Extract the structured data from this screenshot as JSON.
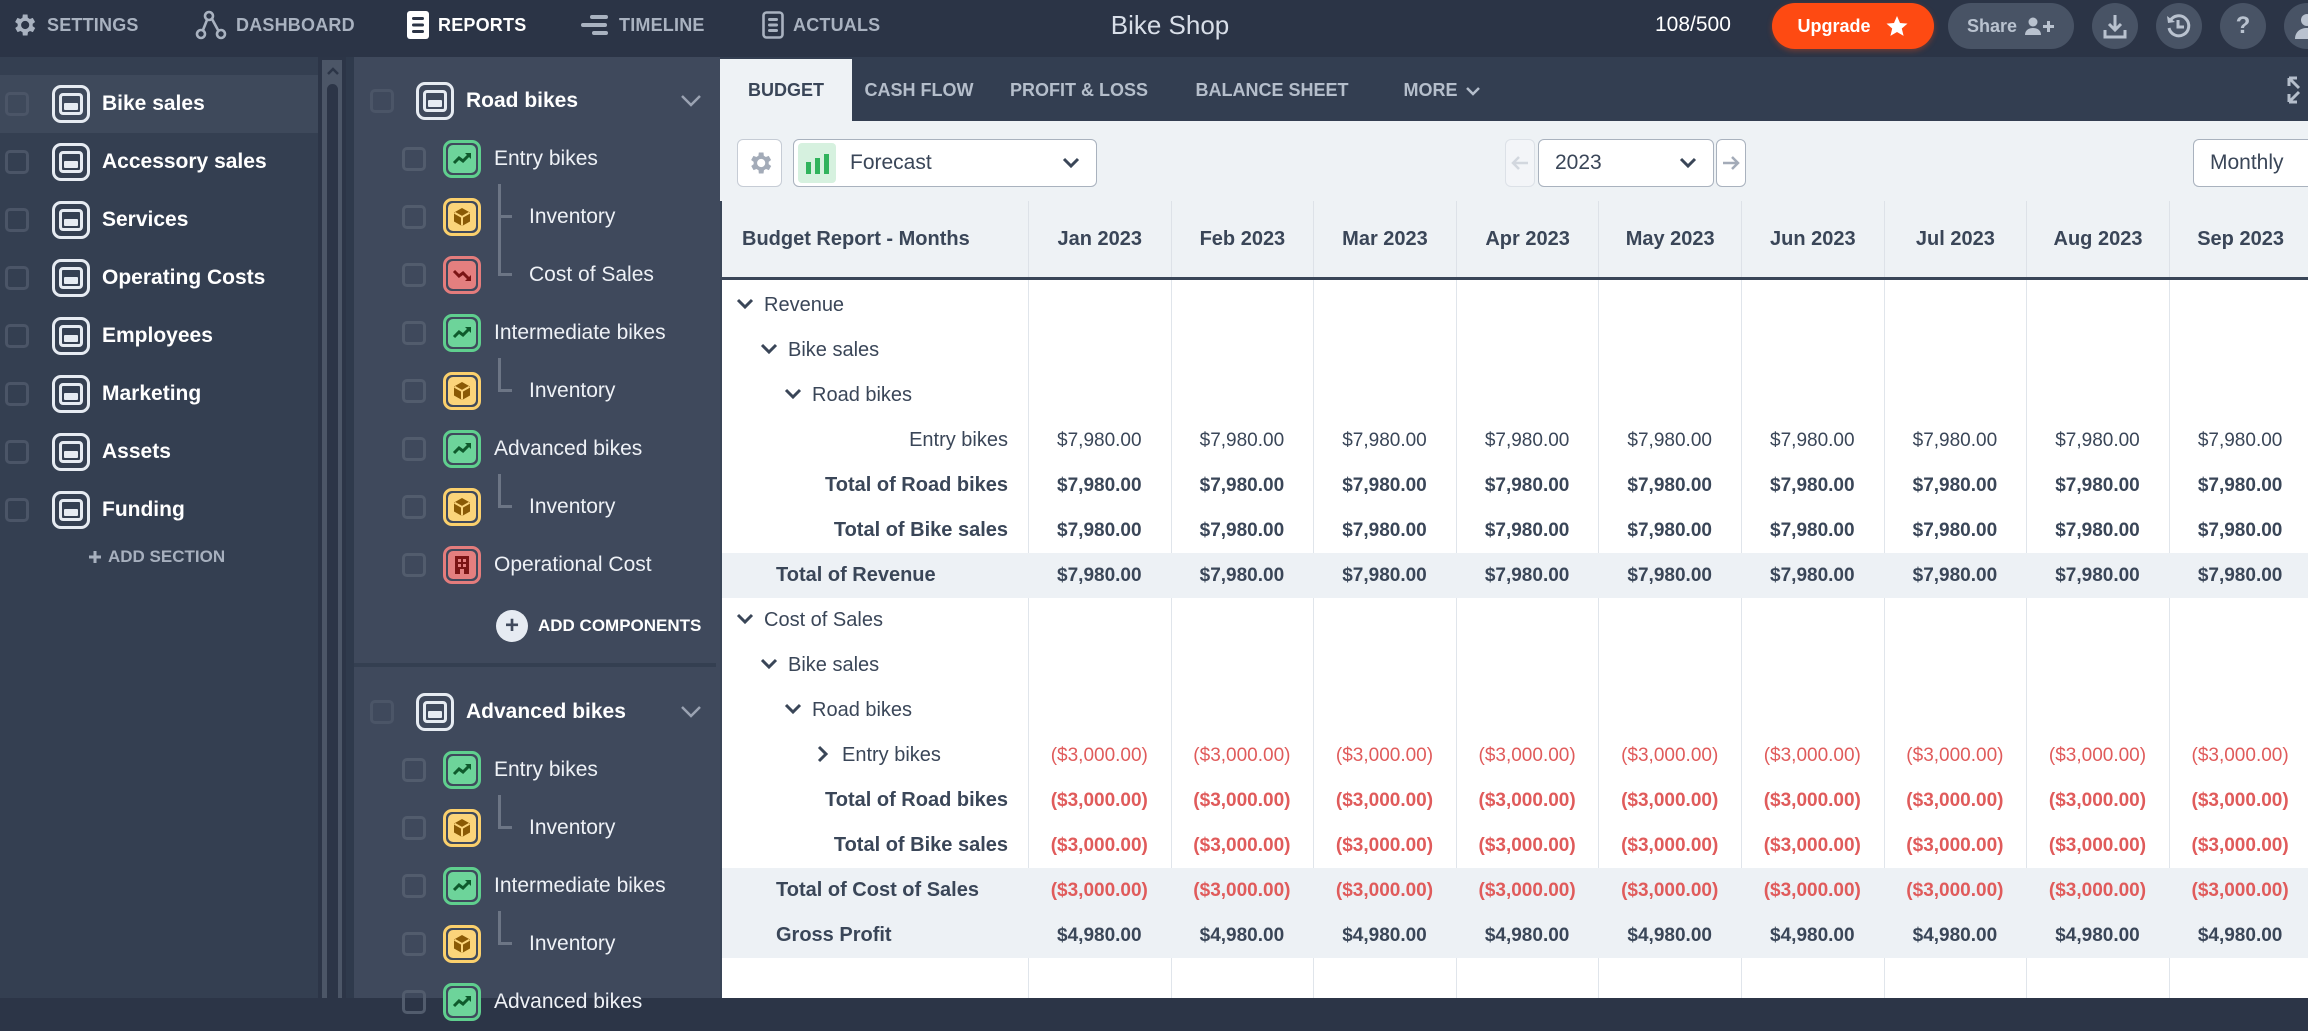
{
  "topbar": {
    "nav": [
      {
        "label": "SETTINGS",
        "icon": "gear-icon",
        "active": false
      },
      {
        "label": "DASHBOARD",
        "icon": "network-icon",
        "active": false
      },
      {
        "label": "REPORTS",
        "icon": "reports-icon",
        "active": true
      },
      {
        "label": "TIMELINE",
        "icon": "timeline-icon",
        "active": false
      },
      {
        "label": "ACTUALS",
        "icon": "actuals-icon",
        "active": false
      }
    ],
    "title": "Bike Shop",
    "counter": "108/500",
    "upgrade_label": "Upgrade",
    "share_label": "Share",
    "help_label": "?"
  },
  "sidebar": {
    "sections": [
      {
        "label": "Bike sales",
        "selected": true
      },
      {
        "label": "Accessory sales",
        "selected": false
      },
      {
        "label": "Services",
        "selected": false
      },
      {
        "label": "Operating Costs",
        "selected": false
      },
      {
        "label": "Employees",
        "selected": false
      },
      {
        "label": "Marketing",
        "selected": false
      },
      {
        "label": "Assets",
        "selected": false
      },
      {
        "label": "Funding",
        "selected": false
      }
    ],
    "add_section_label": "ADD SECTION"
  },
  "components": {
    "groups": [
      {
        "title": "Road bikes",
        "items": [
          {
            "label": "Entry bikes",
            "type": "revenue",
            "sub": false
          },
          {
            "label": "Inventory",
            "type": "inventory",
            "sub": true
          },
          {
            "label": "Cost of Sales",
            "type": "cost",
            "sub": true
          },
          {
            "label": "Intermediate bikes",
            "type": "revenue",
            "sub": false
          },
          {
            "label": "Inventory",
            "type": "inventory",
            "sub": true
          },
          {
            "label": "Advanced bikes",
            "type": "revenue",
            "sub": false
          },
          {
            "label": "Inventory",
            "type": "inventory",
            "sub": true
          },
          {
            "label": "Operational Cost",
            "type": "operational",
            "sub": false
          }
        ]
      },
      {
        "title": "Advanced bikes",
        "items": [
          {
            "label": "Entry bikes",
            "type": "revenue",
            "sub": false
          },
          {
            "label": "Inventory",
            "type": "inventory",
            "sub": true
          },
          {
            "label": "Intermediate bikes",
            "type": "revenue",
            "sub": false
          },
          {
            "label": "Inventory",
            "type": "inventory",
            "sub": true
          },
          {
            "label": "Advanced bikes",
            "type": "revenue",
            "sub": false
          }
        ]
      }
    ],
    "add_components_label": "ADD COMPONENTS"
  },
  "main": {
    "tabs": [
      {
        "label": "BUDGET",
        "active": true
      },
      {
        "label": "CASH FLOW",
        "active": false
      },
      {
        "label": "PROFIT & LOSS",
        "active": false
      },
      {
        "label": "BALANCE SHEET",
        "active": false
      },
      {
        "label": "MORE",
        "active": false
      }
    ],
    "toolbar": {
      "scenario": "Forecast",
      "year": "2023",
      "period": "Monthly"
    },
    "table": {
      "title": "Budget Report - Months",
      "columns": [
        "Jan 2023",
        "Feb 2023",
        "Mar 2023",
        "Apr 2023",
        "May 2023",
        "Jun 2023",
        "Jul 2023",
        "Aug 2023",
        "Sep 2023"
      ],
      "rows": [
        {
          "label": "Revenue",
          "indent": 0,
          "chevron": "down",
          "bold": false,
          "align": "left",
          "shade": false,
          "values": null
        },
        {
          "label": "Bike sales",
          "indent": 1,
          "chevron": "down",
          "bold": false,
          "align": "left",
          "shade": false,
          "values": null
        },
        {
          "label": "Road bikes",
          "indent": 2,
          "chevron": "down",
          "bold": false,
          "align": "left",
          "shade": false,
          "values": null
        },
        {
          "label": "Entry bikes",
          "indent": 3,
          "chevron": null,
          "bold": false,
          "align": "right",
          "shade": false,
          "values": [
            "$7,980.00",
            "$7,980.00",
            "$7,980.00",
            "$7,980.00",
            "$7,980.00",
            "$7,980.00",
            "$7,980.00",
            "$7,980.00",
            "$7,980.00"
          ]
        },
        {
          "label": "Total of Road bikes",
          "indent": 3,
          "chevron": null,
          "bold": true,
          "align": "right",
          "shade": false,
          "values": [
            "$7,980.00",
            "$7,980.00",
            "$7,980.00",
            "$7,980.00",
            "$7,980.00",
            "$7,980.00",
            "$7,980.00",
            "$7,980.00",
            "$7,980.00"
          ]
        },
        {
          "label": "Total of Bike sales",
          "indent": 2,
          "chevron": null,
          "bold": true,
          "align": "right",
          "shade": false,
          "values": [
            "$7,980.00",
            "$7,980.00",
            "$7,980.00",
            "$7,980.00",
            "$7,980.00",
            "$7,980.00",
            "$7,980.00",
            "$7,980.00",
            "$7,980.00"
          ]
        },
        {
          "label": "Total of Revenue",
          "indent": 1,
          "chevron": null,
          "bold": true,
          "align": "left",
          "shade": true,
          "values": [
            "$7,980.00",
            "$7,980.00",
            "$7,980.00",
            "$7,980.00",
            "$7,980.00",
            "$7,980.00",
            "$7,980.00",
            "$7,980.00",
            "$7,980.00"
          ]
        },
        {
          "label": "Cost of Sales",
          "indent": 0,
          "chevron": "down",
          "bold": false,
          "align": "left",
          "shade": false,
          "values": null
        },
        {
          "label": "Bike sales",
          "indent": 1,
          "chevron": "down",
          "bold": false,
          "align": "left",
          "shade": false,
          "values": null
        },
        {
          "label": "Road bikes",
          "indent": 2,
          "chevron": "down",
          "bold": false,
          "align": "left",
          "shade": false,
          "values": null
        },
        {
          "label": "Entry bikes",
          "indent": 3,
          "chevron": "right",
          "bold": false,
          "align": "left",
          "shade": false,
          "negative": true,
          "values": [
            "($3,000.00)",
            "($3,000.00)",
            "($3,000.00)",
            "($3,000.00)",
            "($3,000.00)",
            "($3,000.00)",
            "($3,000.00)",
            "($3,000.00)",
            "($3,000.00)"
          ]
        },
        {
          "label": "Total of Road bikes",
          "indent": 3,
          "chevron": null,
          "bold": true,
          "align": "right",
          "shade": false,
          "negative": true,
          "values": [
            "($3,000.00)",
            "($3,000.00)",
            "($3,000.00)",
            "($3,000.00)",
            "($3,000.00)",
            "($3,000.00)",
            "($3,000.00)",
            "($3,000.00)",
            "($3,000.00)"
          ]
        },
        {
          "label": "Total of Bike sales",
          "indent": 2,
          "chevron": null,
          "bold": true,
          "align": "right",
          "shade": false,
          "negative": true,
          "values": [
            "($3,000.00)",
            "($3,000.00)",
            "($3,000.00)",
            "($3,000.00)",
            "($3,000.00)",
            "($3,000.00)",
            "($3,000.00)",
            "($3,000.00)",
            "($3,000.00)"
          ]
        },
        {
          "label": "Total of Cost of Sales",
          "indent": 1,
          "chevron": null,
          "bold": true,
          "align": "left",
          "shade": true,
          "negative": true,
          "values": [
            "($3,000.00)",
            "($3,000.00)",
            "($3,000.00)",
            "($3,000.00)",
            "($3,000.00)",
            "($3,000.00)",
            "($3,000.00)",
            "($3,000.00)",
            "($3,000.00)"
          ]
        },
        {
          "label": "Gross Profit",
          "indent": 1,
          "chevron": null,
          "bold": true,
          "align": "left",
          "shade": true,
          "values": [
            "$4,980.00",
            "$4,980.00",
            "$4,980.00",
            "$4,980.00",
            "$4,980.00",
            "$4,980.00",
            "$4,980.00",
            "$4,980.00",
            "$4,980.00"
          ]
        }
      ]
    }
  },
  "colors": {
    "accent": "#fe4a12",
    "negative": "#e05b5b",
    "revenue_icon": "#6dd49a",
    "inventory_icon": "#fbd47a",
    "cost_icon": "#e47f7f"
  }
}
